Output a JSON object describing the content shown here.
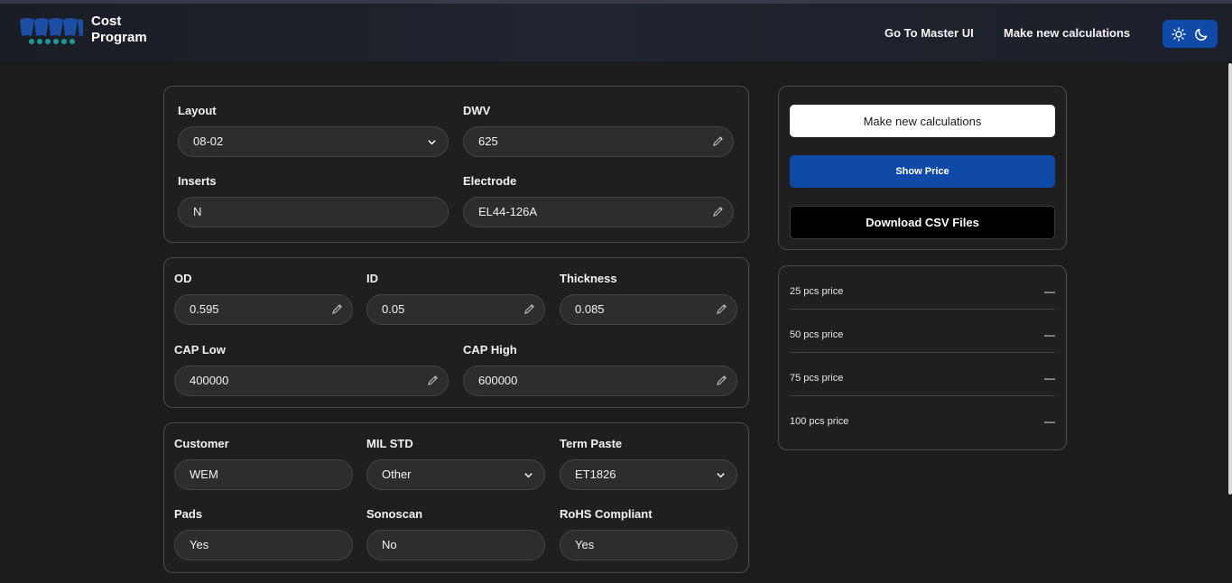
{
  "header": {
    "brand_line1": "Cost",
    "brand_line2": "Program",
    "nav_master": "Go To Master UI",
    "nav_new": "Make new calculations",
    "theme_icons": [
      "sun-icon",
      "moon-icon"
    ],
    "accent_color": "#0f4aa8"
  },
  "form_layout": {
    "layout": {
      "label": "Layout",
      "value": "08-02"
    },
    "dwv": {
      "label": "DWV",
      "value": "625"
    },
    "inserts": {
      "label": "Inserts",
      "value": "N"
    },
    "electrode": {
      "label": "Electrode",
      "value": "EL44-126A"
    }
  },
  "form_dims": {
    "od": {
      "label": "OD",
      "value": "0.595"
    },
    "id": {
      "label": "ID",
      "value": "0.05"
    },
    "thickness": {
      "label": "Thickness",
      "value": "0.085"
    },
    "cap_low": {
      "label": "CAP Low",
      "value": "400000"
    },
    "cap_high": {
      "label": "CAP High",
      "value": "600000"
    }
  },
  "form_customer": {
    "customer": {
      "label": "Customer",
      "value": "WEM"
    },
    "mil_std": {
      "label": "MIL STD",
      "value": "Other"
    },
    "term_paste": {
      "label": "Term Paste",
      "value": "ET1826"
    },
    "pads": {
      "label": "Pads",
      "value": "Yes"
    },
    "sonoscan": {
      "label": "Sonoscan",
      "value": "No"
    },
    "rohs": {
      "label": "RoHS Compliant",
      "value": "Yes"
    }
  },
  "actions": {
    "make_new": "Make new calculations",
    "show_price": "Show Price",
    "download_csv": "Download CSV Files"
  },
  "prices": [
    {
      "label": "25 pcs price",
      "value": "—"
    },
    {
      "label": "50 pcs price",
      "value": "—"
    },
    {
      "label": "75 pcs price",
      "value": "—"
    },
    {
      "label": "100 pcs price",
      "value": "—"
    }
  ]
}
